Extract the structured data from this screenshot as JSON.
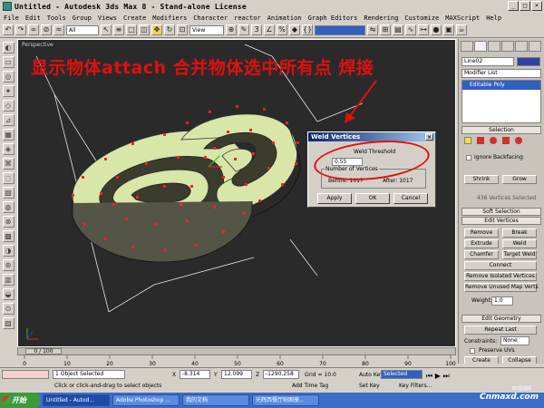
{
  "window": {
    "title": "Untitled - Autodesk 3ds Max 8 - Stand-alone License"
  },
  "menu": [
    "File",
    "Edit",
    "Tools",
    "Group",
    "Views",
    "Create",
    "Modifiers",
    "Character",
    "reactor",
    "Animation",
    "Graph Editors",
    "Rendering",
    "Customize",
    "MAXScript",
    "Help"
  ],
  "toolbar": {
    "selection_filter": "All",
    "ref_coord": "View"
  },
  "viewport": {
    "label": "Perspective",
    "overlay_text": "显示物体attach 合并物体选中所有点 焊接"
  },
  "dialog": {
    "title": "Weld Vertices",
    "threshold_label": "Weld Threshold",
    "threshold_value": "0.55",
    "count_label": "Number of Vertices",
    "before": "Before: 1017",
    "after": "After:  1017",
    "apply": "Apply",
    "ok": "OK",
    "cancel": "Cancel"
  },
  "command_panel": {
    "object_name": "Line02",
    "modifier_list": "Modifier List",
    "stack_item": "Editable Poly",
    "selection_header": "Selection",
    "ignore_backfacing": "Ignore Backfacing",
    "shrink": "Shrink",
    "grow": "Grow",
    "selected_count": "436 Vertices Selected",
    "soft_selection": "Soft Selection",
    "edit_vertices": "Edit Vertices",
    "remove": "Remove",
    "break": "Break",
    "extrude": "Extrude",
    "weld": "Weld",
    "chamfer": "Chamfer",
    "target_weld": "Target Weld",
    "connect": "Connect",
    "remove_isolated": "Remove Isolated Vertices",
    "remove_unused": "Remove Unused Map Verts",
    "weight_label": "Weight:",
    "weight_value": "1.0",
    "edit_geometry": "Edit Geometry",
    "repeat_last": "Repeat Last",
    "constraints_label": "Constraints:",
    "constraints_value": "None",
    "preserve_uvs": "Preserve UVs",
    "create": "Create",
    "collapse": "Collapse"
  },
  "timeline": {
    "frame": "0 / 100",
    "ticks": [
      "0",
      "10",
      "20",
      "30",
      "40",
      "50",
      "60",
      "70",
      "80",
      "90",
      "100"
    ]
  },
  "status": {
    "objects_selected": "1 Object Selected",
    "prompt": "Click or click-and-drag to select objects",
    "x": "-8.314",
    "y": "12.099",
    "z": "-1290.258",
    "grid": "Grid = 10.0",
    "add_time_tag": "Add Time Tag",
    "auto_key": "Auto Key",
    "key_selection": "Selected",
    "set_key": "Set Key",
    "key_filters": "Key Filters..."
  },
  "taskbar": {
    "start": "开始",
    "tasks": [
      "Untitled - Autod...",
      "Adobe Photoshop ...",
      "我的文档",
      "光辉西餐厅贴图册..."
    ]
  },
  "watermark": {
    "text": "Cnmaxd.com",
    "small": "3D溜溜网"
  }
}
